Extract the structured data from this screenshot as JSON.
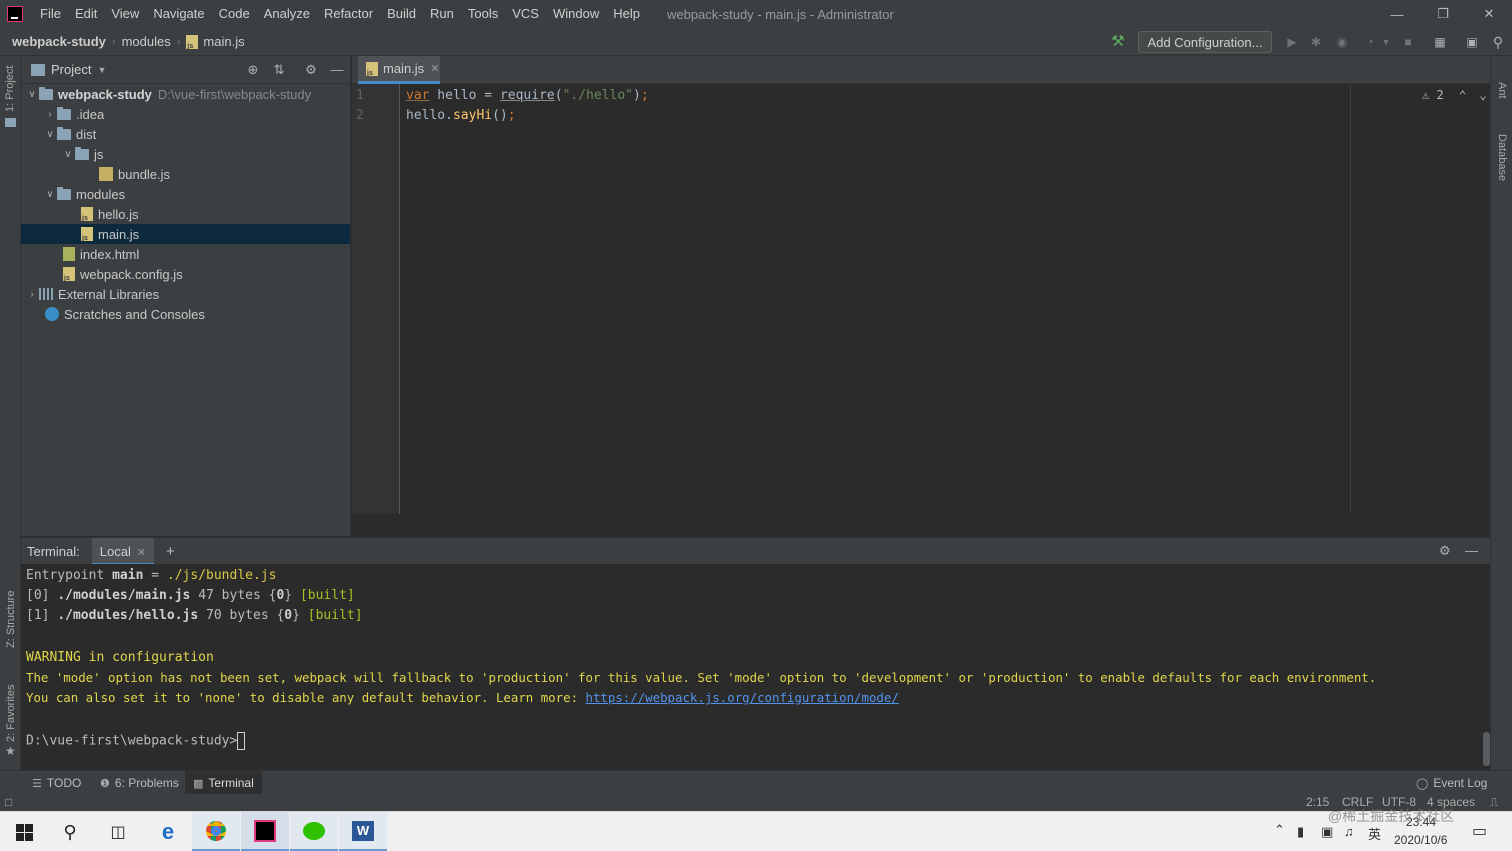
{
  "titlebar": {
    "menu": [
      "File",
      "Edit",
      "View",
      "Navigate",
      "Code",
      "Analyze",
      "Refactor",
      "Build",
      "Run",
      "Tools",
      "VCS",
      "Window",
      "Help"
    ],
    "window_title": "webpack-study - main.js - Administrator"
  },
  "navbar": {
    "crumbs": [
      "webpack-study",
      "modules",
      "main.js"
    ],
    "add_config_label": "Add Configuration..."
  },
  "left_strip": {
    "project": "1: Project",
    "structure": "Z: Structure",
    "favorites": "2: Favorites"
  },
  "right_strip": {
    "ant": "Ant",
    "database": "Database"
  },
  "project_panel": {
    "title": "Project",
    "tree": [
      {
        "label": "webpack-study",
        "path": "D:\\vue-first\\webpack-study"
      },
      {
        "label": ".idea"
      },
      {
        "label": "dist"
      },
      {
        "label": "js"
      },
      {
        "label": "bundle.js"
      },
      {
        "label": "modules"
      },
      {
        "label": "hello.js"
      },
      {
        "label": "main.js"
      },
      {
        "label": "index.html"
      },
      {
        "label": "webpack.config.js"
      },
      {
        "label": "External Libraries"
      },
      {
        "label": "Scratches and Consoles"
      }
    ]
  },
  "editor": {
    "tab_label": "main.js",
    "line_numbers": [
      "1",
      "2"
    ],
    "line1": {
      "kw": "var",
      "a": " hello = ",
      "fn": "require",
      "b": "(",
      "str": "\"./hello\"",
      "c": ")",
      "semi": ";"
    },
    "line2": {
      "a": "hello.",
      "meth": "sayHi",
      "b": "()",
      "semi": ";"
    },
    "warning_count": "2"
  },
  "terminal": {
    "title": "Terminal:",
    "tab_label": "Local",
    "lines": {
      "l1a": "Entrypoint ",
      "l1b": "main",
      "l1c": " = ",
      "l1d": "./js/bundle.js",
      "l2a": "[0] ",
      "l2b": "./modules/main.js",
      "l2c": " 47 bytes {",
      "l2d": "0",
      "l2e": "} ",
      "l2f": "[built]",
      "l3a": "[1] ",
      "l3b": "./modules/hello.js",
      "l3c": " 70 bytes {",
      "l3d": "0",
      "l3e": "} ",
      "l3f": "[built]",
      "warn": "WARNING in configuration",
      "warn2": "The 'mode' option has not been set, webpack will fallback to 'production' for this value. Set 'mode' option to 'development' or 'production' to enable defaults for each environment.",
      "warn3a": "You can also set it to 'none' to disable any default behavior. Learn more: ",
      "warn3link": "https://webpack.js.org/configuration/mode/",
      "prompt": "D:\\vue-first\\webpack-study>"
    }
  },
  "bottom_tools": {
    "todo": "TODO",
    "problems": "6: Problems",
    "terminal": "Terminal",
    "event_log": "Event Log"
  },
  "status": {
    "position": "2:15",
    "line_sep": "CRLF",
    "encoding": "UTF-8",
    "indent": "4 spaces"
  },
  "taskbar": {
    "time": "23:44",
    "date": "2020/10/6",
    "ime": "英",
    "watermark": "@稀土掘金技术社区"
  },
  "colors": {
    "accent": "#4a88c7",
    "selection": "#0d293e",
    "warning_text": "#e0d64a"
  }
}
